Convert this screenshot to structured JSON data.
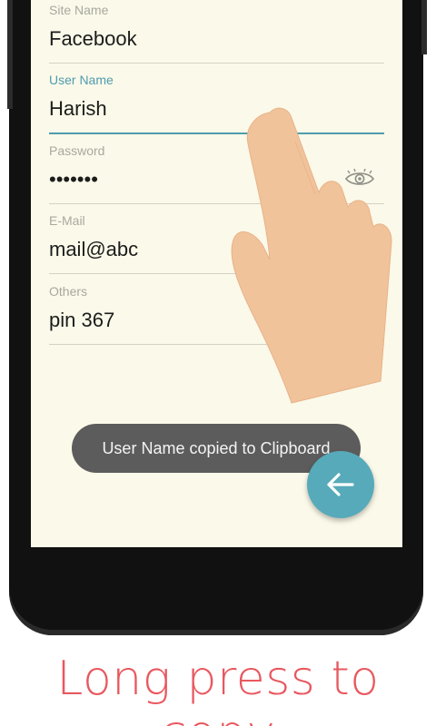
{
  "form": {
    "site_name": {
      "label": "Site Name",
      "value": "Facebook"
    },
    "user_name": {
      "label": "User Name",
      "value": "Harish"
    },
    "password": {
      "label": "Password",
      "value": "•••••••",
      "toggle_icon": "eye-icon"
    },
    "email": {
      "label": "E-Mail",
      "value": "mail@abc"
    },
    "others": {
      "label": "Others",
      "value": "pin 367"
    }
  },
  "toast": {
    "text": "User Name copied to Clipboard"
  },
  "fab": {
    "icon": "arrow-left-icon"
  },
  "caption": {
    "text": "Long press to copy"
  },
  "colors": {
    "accent": "#4f9cb0",
    "fab": "#57aab9",
    "screen_bg": "#fbf9e9",
    "caption": "#e8585f",
    "toast_bg": "#5c5c5c"
  }
}
